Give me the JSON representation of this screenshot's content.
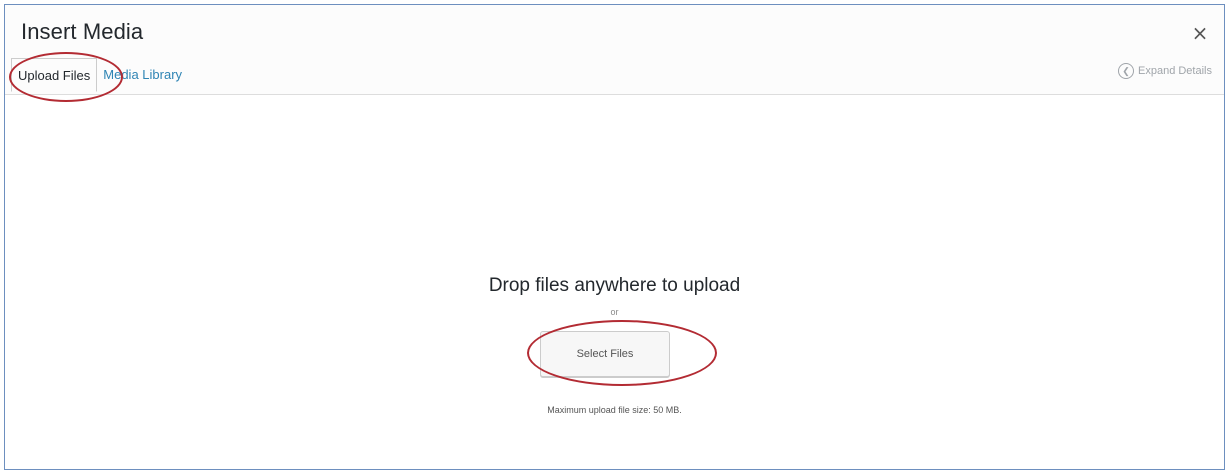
{
  "modal": {
    "title": "Insert Media",
    "close_label": "×"
  },
  "tabs": [
    {
      "label": "Upload Files",
      "active": true
    },
    {
      "label": "Media Library",
      "active": false
    }
  ],
  "expand_details": {
    "label": "Expand Details",
    "icon": "chevron-left-circle-icon"
  },
  "uploader": {
    "drop_text": "Drop files anywhere to upload",
    "or_text": "or",
    "select_button": "Select Files",
    "max_size_text": "Maximum upload file size: 50 MB."
  },
  "colors": {
    "link": "#2e84b4",
    "annotation": "#b32b33",
    "frame_border": "#6d8fbf"
  }
}
